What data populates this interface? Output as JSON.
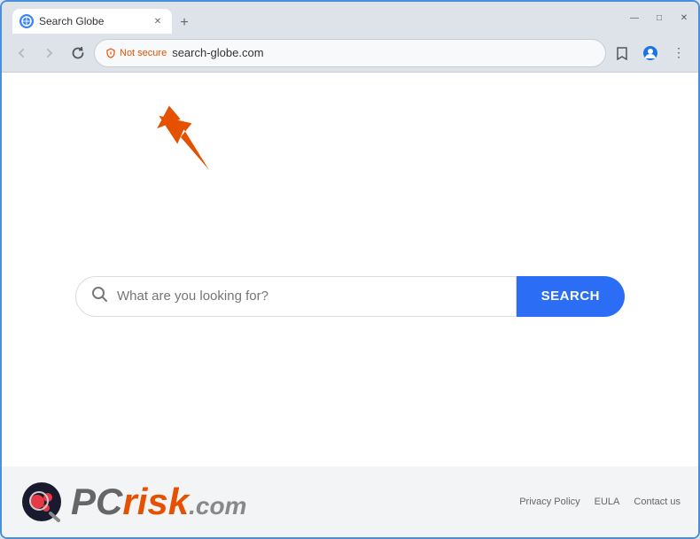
{
  "browser": {
    "tab": {
      "title": "Search Globe",
      "favicon_label": "SG"
    },
    "window_controls": {
      "minimize": "—",
      "maximize": "□",
      "close": "✕"
    },
    "new_tab_btn": "+",
    "toolbar": {
      "back_btn": "←",
      "forward_btn": "→",
      "refresh_btn": "↻",
      "security_label": "Not secure",
      "address": "search-globe.com",
      "bookmark_icon": "☆",
      "profile_icon": "👤",
      "menu_icon": "⋮"
    }
  },
  "page": {
    "search": {
      "placeholder": "What are you looking for?",
      "button_label": "SEARCH"
    },
    "annotation": {
      "arrow_color": "#e65100"
    }
  },
  "footer": {
    "brand": "PCrisk",
    "brand_colored_part": "risk",
    "brand_prefix": "PC",
    "links": [
      "Privacy Policy",
      "EULA",
      "Contact us"
    ]
  }
}
